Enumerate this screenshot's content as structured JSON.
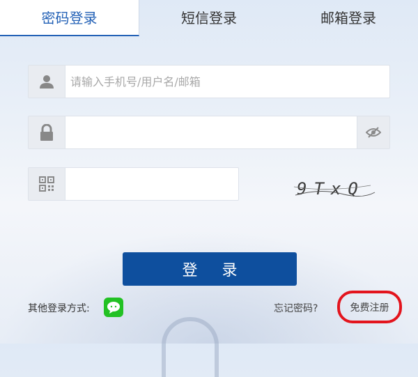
{
  "tabs": {
    "password": "密码登录",
    "sms": "短信登录",
    "email": "邮箱登录"
  },
  "form": {
    "account_placeholder": "请输入手机号/用户名/邮箱",
    "password_value": "",
    "captcha_value": "",
    "captcha_text": "9TxQ",
    "submit": "登 录"
  },
  "footer": {
    "other_methods": "其他登录方式:",
    "forgot": "忘记密码?",
    "register": "免费注册"
  },
  "colors": {
    "accent": "#2361b6",
    "button": "#0e4f9e",
    "wechat": "#22c123",
    "highlight": "#e3141d"
  },
  "icons": [
    "user-icon",
    "lock-icon",
    "qrcode-icon",
    "eye-icon",
    "wechat-icon"
  ]
}
